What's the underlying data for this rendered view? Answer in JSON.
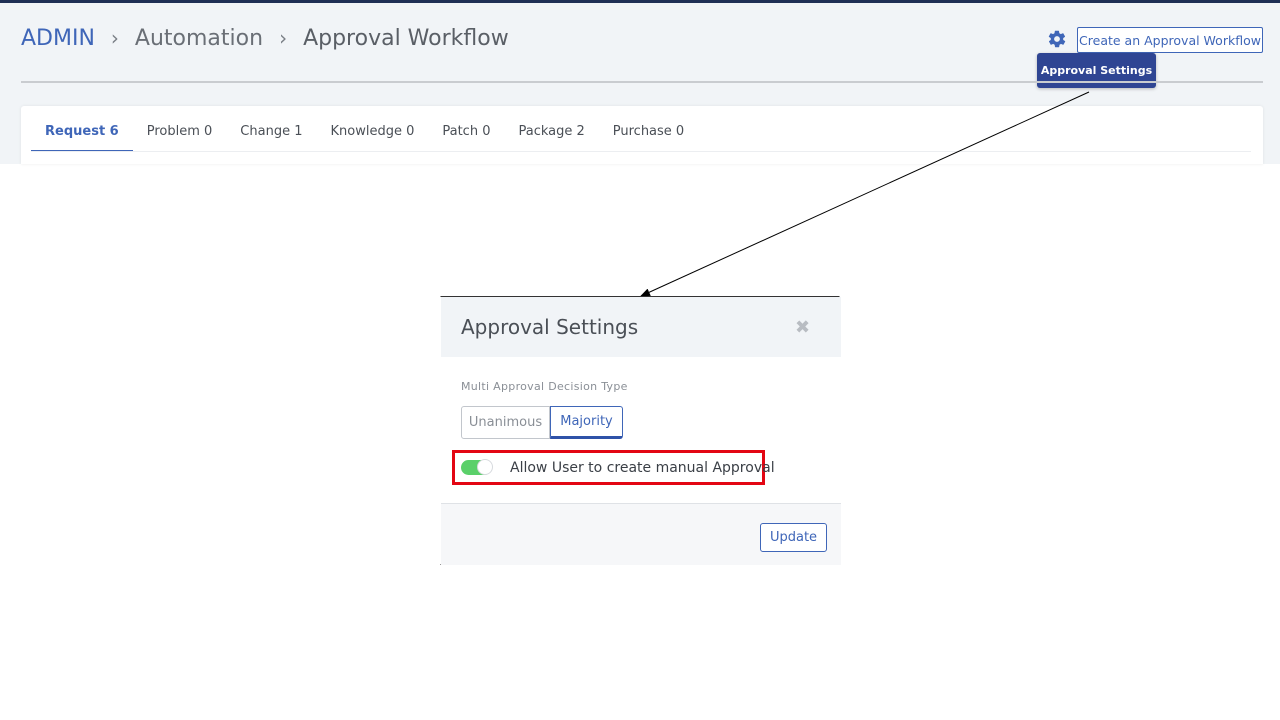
{
  "breadcrumb": {
    "root": "ADMIN",
    "middle": "Automation",
    "current": "Approval Workflow",
    "separator": "›"
  },
  "header": {
    "settings_icon": "gear-icon",
    "create_button": "Create an Approval Workflow",
    "tooltip": "Approval Settings"
  },
  "tabs": [
    {
      "label": "Request 6",
      "active": true
    },
    {
      "label": "Problem 0",
      "active": false
    },
    {
      "label": "Change 1",
      "active": false
    },
    {
      "label": "Knowledge 0",
      "active": false
    },
    {
      "label": "Patch 0",
      "active": false
    },
    {
      "label": "Package 2",
      "active": false
    },
    {
      "label": "Purchase 0",
      "active": false
    }
  ],
  "modal": {
    "title": "Approval Settings",
    "close_icon": "close-icon",
    "decision_label": "Multi Approval Decision Type",
    "options": [
      "Unanimous",
      "Majority"
    ],
    "selected_option": "Majority",
    "toggle_label": "Allow User to create manual Approval",
    "toggle_on": true,
    "update_button": "Update"
  },
  "colors": {
    "accent": "#3f66b8",
    "tooltip_bg": "#2f4593",
    "toggle_on": "#5bd06a",
    "highlight": "#e30613"
  }
}
